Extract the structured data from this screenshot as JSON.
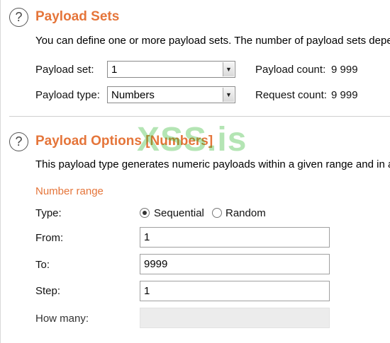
{
  "payload_sets": {
    "title": "Payload Sets",
    "description": "You can define one or more payload sets. The number of payload sets depends on the attack type",
    "payload_set_label": "Payload set:",
    "payload_set_value": "1",
    "payload_type_label": "Payload type:",
    "payload_type_value": "Numbers",
    "payload_count_label": "Payload count:",
    "payload_count_value": "9 999",
    "request_count_label": "Request count:",
    "request_count_value": "9 999"
  },
  "payload_options": {
    "title": "Payload Options [Numbers]",
    "description": "This payload type generates numeric payloads within a given range and in a specified format.",
    "section_label": "Number range",
    "type_label": "Type:",
    "type_options": [
      "Sequential",
      "Random"
    ],
    "type_selected": "Sequential",
    "from_label": "From:",
    "from_value": "1",
    "to_label": "To:",
    "to_value": "9999",
    "step_label": "Step:",
    "step_value": "1",
    "how_many_label": "How many:",
    "how_many_value": ""
  },
  "watermark": "XSS.is",
  "icons": {
    "help": "help-icon",
    "dropdown": "chevron-down-icon"
  },
  "colors": {
    "accent": "#e5753a"
  }
}
